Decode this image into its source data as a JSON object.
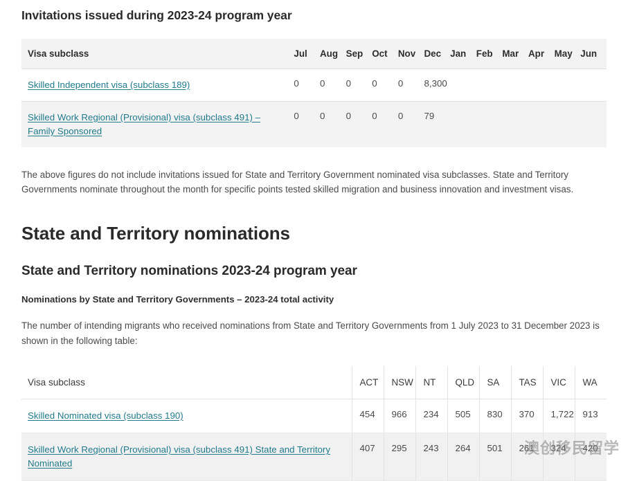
{
  "invitations_section": {
    "heading": "Invitations issued during 2023-24 program year",
    "table": {
      "subclass_header": "Visa subclass",
      "month_headers": [
        "Jul",
        "Aug",
        "Sep",
        "Oct",
        "Nov",
        "Dec",
        "Jan",
        "Feb",
        "Mar",
        "Apr",
        "May",
        "Jun"
      ],
      "rows": [
        {
          "label": "Skilled Independent visa (subclass 189)",
          "values": [
            "0",
            "0",
            "0",
            "0",
            "0",
            "8,300",
            "",
            "",
            "",
            "",
            "",
            ""
          ]
        },
        {
          "label": "Skilled Work Regional (Provisional) visa (subclass 491) – Family Sponsored",
          "values": [
            "0",
            "0",
            "0",
            "0",
            "0",
            "79",
            "",
            "",
            "",
            "",
            "",
            ""
          ]
        }
      ]
    },
    "note": "The above figures do not include invitations issued for State and Territory Government nominated visa subclasses. State and Territory Governments nominate throughout the month for specific points tested skilled migration and business innovation and investment visas."
  },
  "nominations_section": {
    "heading": "State and Territory nominations",
    "subheading": "State and Territory nominations 2023-24 program year",
    "caption": "Nominations by State and Territory Governments – 2023-24 total activity",
    "intro": "The number of intending migrants who received nominations from State and Territory Governments from 1 July 2023 to 31 December 2023 is shown in the following table:",
    "table": {
      "subclass_header": "Visa subclass",
      "state_headers": [
        "ACT",
        "NSW",
        "NT",
        "QLD",
        "SA",
        "TAS",
        "VIC",
        "WA"
      ],
      "rows": [
        {
          "label": "Skilled Nominated visa (subclass 190)",
          "values": [
            "454",
            "966",
            "234",
            "505",
            "830",
            "370",
            "1,722",
            "913"
          ]
        },
        {
          "label": "Skilled Work Regional (Provisional) visa (subclass 491) State and Territory Nominated",
          "values": [
            "407",
            "295",
            "243",
            "264",
            "501",
            "261",
            "324",
            "420"
          ]
        }
      ]
    }
  },
  "watermark": {
    "text": "澳创移民留学"
  },
  "chart_data": {
    "type": "table",
    "title": "Invitations issued during 2023-24 program year",
    "tables": [
      {
        "name": "invitations-by-month",
        "columns": [
          "Visa subclass",
          "Jul",
          "Aug",
          "Sep",
          "Oct",
          "Nov",
          "Dec",
          "Jan",
          "Feb",
          "Mar",
          "Apr",
          "May",
          "Jun"
        ],
        "rows": [
          [
            "Skilled Independent visa (subclass 189)",
            "0",
            "0",
            "0",
            "0",
            "0",
            "8,300",
            "",
            "",
            "",
            "",
            "",
            ""
          ],
          [
            "Skilled Work Regional (Provisional) visa (subclass 491) – Family Sponsored",
            "0",
            "0",
            "0",
            "0",
            "0",
            "79",
            "",
            "",
            "",
            "",
            "",
            ""
          ]
        ]
      },
      {
        "name": "nominations-by-state",
        "columns": [
          "Visa subclass",
          "ACT",
          "NSW",
          "NT",
          "QLD",
          "SA",
          "TAS",
          "VIC",
          "WA"
        ],
        "rows": [
          [
            "Skilled Nominated visa (subclass 190)",
            "454",
            "966",
            "234",
            "505",
            "830",
            "370",
            "1,722",
            "913"
          ],
          [
            "Skilled Work Regional (Provisional) visa (subclass 491) State and Territory Nominated",
            "407",
            "295",
            "243",
            "264",
            "501",
            "261",
            "324",
            "420"
          ]
        ]
      }
    ]
  }
}
